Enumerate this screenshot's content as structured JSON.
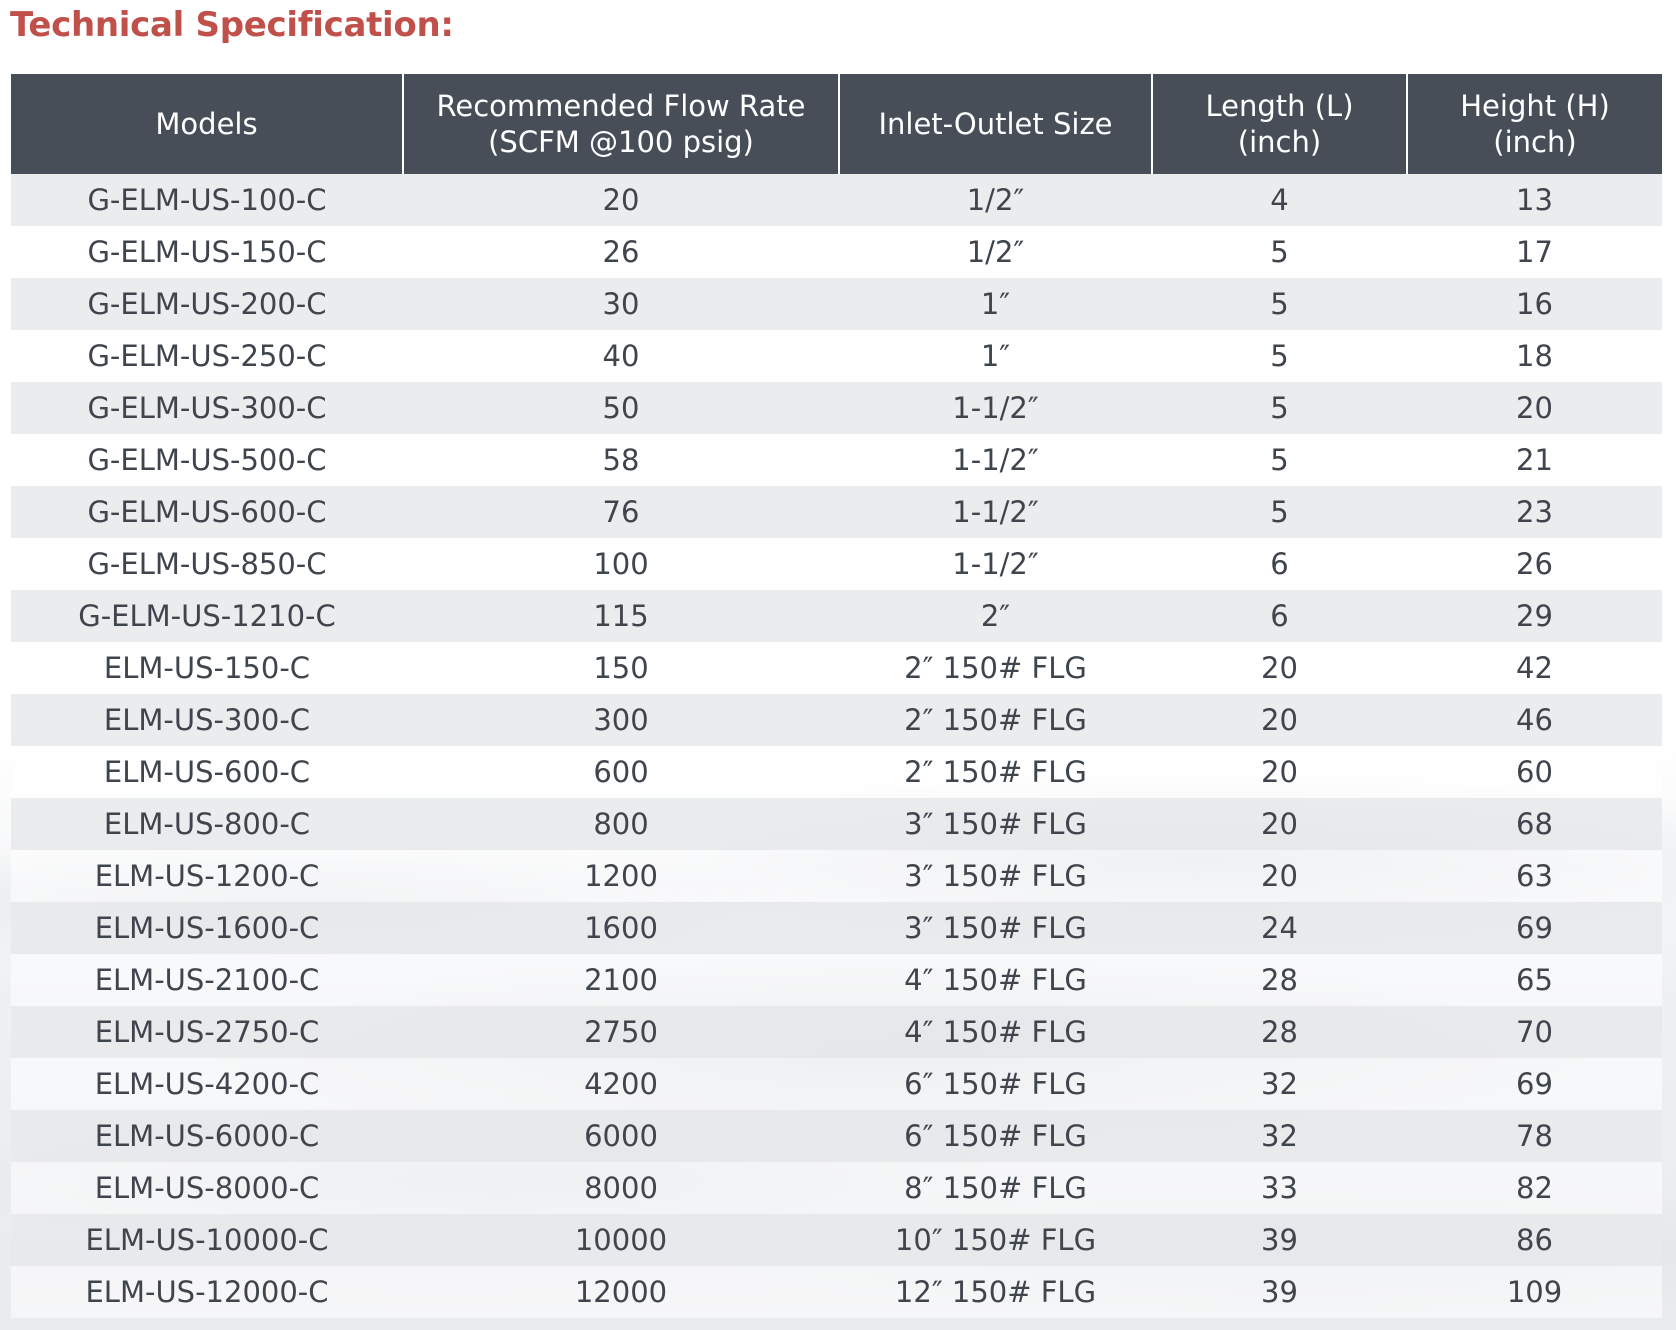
{
  "title": "Technical Specification:",
  "table": {
    "headers": [
      [
        "Models"
      ],
      [
        "Recommended Flow Rate",
        "(SCFM @100 psig)"
      ],
      [
        "Inlet-Outlet Size"
      ],
      [
        "Length (L) (inch)"
      ],
      [
        "Height (H)",
        "(inch)"
      ]
    ],
    "rows": [
      [
        "G-ELM-US-100-C",
        "20",
        "1/2″",
        "4",
        "13"
      ],
      [
        "G-ELM-US-150-C",
        "26",
        "1/2″",
        "5",
        "17"
      ],
      [
        "G-ELM-US-200-C",
        "30",
        "1″",
        "5",
        "16"
      ],
      [
        "G-ELM-US-250-C",
        "40",
        "1″",
        "5",
        "18"
      ],
      [
        "G-ELM-US-300-C",
        "50",
        "1-1/2″",
        "5",
        "20"
      ],
      [
        "G-ELM-US-500-C",
        "58",
        "1-1/2″",
        "5",
        "21"
      ],
      [
        "G-ELM-US-600-C",
        "76",
        "1-1/2″",
        "5",
        "23"
      ],
      [
        "G-ELM-US-850-C",
        "100",
        "1-1/2″",
        "6",
        "26"
      ],
      [
        "G-ELM-US-1210-C",
        "115",
        "2″",
        "6",
        "29"
      ],
      [
        "ELM-US-150-C",
        "150",
        "2″ 150# FLG",
        "20",
        "42"
      ],
      [
        "ELM-US-300-C",
        "300",
        "2″ 150# FLG",
        "20",
        "46"
      ],
      [
        "ELM-US-600-C",
        "600",
        "2″ 150# FLG",
        "20",
        "60"
      ],
      [
        "ELM-US-800-C",
        "800",
        "3″ 150# FLG",
        "20",
        "68"
      ],
      [
        "ELM-US-1200-C",
        "1200",
        "3″ 150# FLG",
        "20",
        "63"
      ],
      [
        "ELM-US-1600-C",
        "1600",
        "3″ 150# FLG",
        "24",
        "69"
      ],
      [
        "ELM-US-2100-C",
        "2100",
        "4″ 150# FLG",
        "28",
        "65"
      ],
      [
        "ELM-US-2750-C",
        "2750",
        "4″ 150# FLG",
        "28",
        "70"
      ],
      [
        "ELM-US-4200-C",
        "4200",
        "6″ 150# FLG",
        "32",
        "69"
      ],
      [
        "ELM-US-6000-C",
        "6000",
        "6″ 150# FLG",
        "32",
        "78"
      ],
      [
        "ELM-US-8000-C",
        "8000",
        "8″ 150# FLG",
        "33",
        "82"
      ],
      [
        "ELM-US-10000-C",
        "10000",
        "10″ 150# FLG",
        "39",
        "86"
      ],
      [
        "ELM-US-12000-C",
        "12000",
        "12″ 150# FLG",
        "39",
        "109"
      ]
    ]
  },
  "colors": {
    "title": "#c0504a",
    "header_bg": "#474e57",
    "header_text": "#ffffff",
    "body_text": "#3f454c",
    "stripe": "#e8e9eb"
  }
}
